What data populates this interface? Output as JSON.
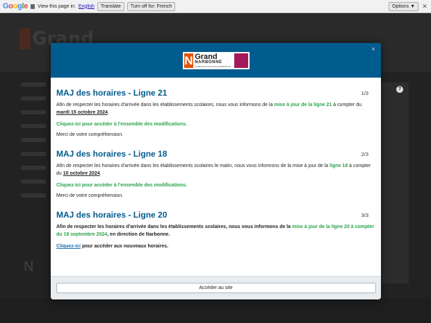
{
  "translate_bar": {
    "logo_letters": [
      "G",
      "o",
      "o",
      "g",
      "l",
      "e"
    ],
    "view_text": "View this page in:",
    "language": "English",
    "translate_btn": "Translate",
    "turn_off_btn": "Turn off for: French",
    "options_btn": "Options ▼",
    "close": "✕"
  },
  "background": {
    "logo_text": "Grand",
    "logo_n": "N",
    "help_badge": "?"
  },
  "modal": {
    "close": "×",
    "logo": {
      "n": "N",
      "grand": "Grand",
      "narbonne": "NARBONNE",
      "sub": "COMMUNAUTÉ D'AGGLOMÉRATION"
    },
    "sections": [
      {
        "title": "MAJ des horaires - Ligne 21",
        "page": "1/3",
        "p1_a": "Afin de respecter les horaires d'arrivée dans les établissements scolaires, nous vous informons de la ",
        "p1_hl": "mise à jour de la ligne 21",
        "p1_b": " à compter du ",
        "p1_date": "mardi 15 octobre 2024",
        "p1_end": ".",
        "link": "Cliquez-ici pour accéder à l'ensemble des modifications.",
        "note": "Merci de votre compréhension."
      },
      {
        "title": "MAJ des horaires - Ligne 18",
        "page": "2/3",
        "p1_a": "Afin de respecter les horaires d'arrivée dans les établissements scolaires le matin, nous vous informons de la mise à jour de la ",
        "p1_hl": "ligne 18",
        "p1_b": " à compter du ",
        "p1_date": "10 octobre 2024",
        "p1_end": ".",
        "link": "Cliquez-ici pour accéder à l'ensemble des modifications.",
        "note": "Merci de votre compréhension."
      },
      {
        "title": "MAJ des horaires - Ligne 20",
        "page": "3/3",
        "p1_a": "Afin de respecter les horaires d'arrivée dans les établissements scolaires, nous vous informons de la ",
        "p1_hl": "mise à jour de la ligne 20 à compter du 18 septembre 2024",
        "p1_b": ", en direction de Narbonne.",
        "link_a": "Cliquez-ici",
        "link_b": " pour accéder aux nouveaux horaires."
      }
    ],
    "access_button": "Accéder au site"
  },
  "colors": {
    "header_blue": "#005b8e",
    "title_blue": "#005b8e",
    "green": "#2aa44a",
    "link_blue": "#1a6fb2"
  }
}
